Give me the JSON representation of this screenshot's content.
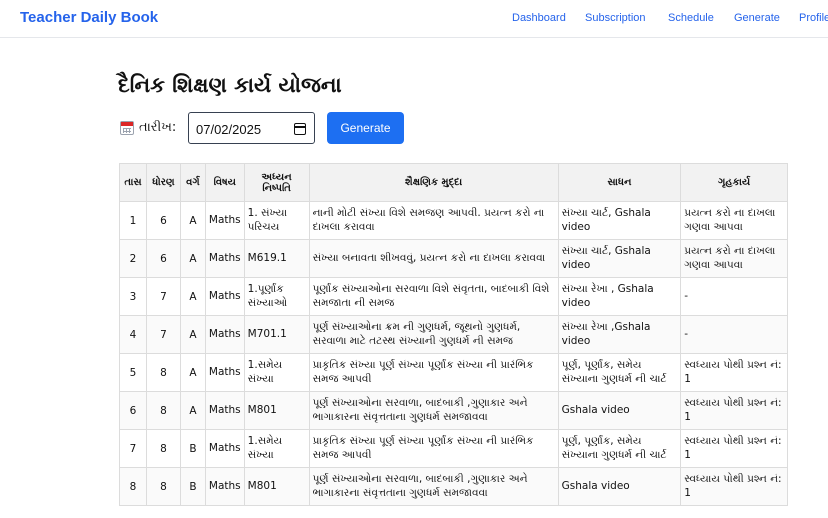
{
  "nav": {
    "brand": "Teacher Daily Book",
    "links": [
      "Dashboard",
      "Subscription",
      "Schedule",
      "Generate",
      "Profile"
    ]
  },
  "page": {
    "title": "દૈનિક શિક્ષણ કાર્ય યોજના",
    "date_label": "તારીખ:",
    "date_value": "07/02/2025",
    "generate_label": "Generate"
  },
  "table": {
    "headers": [
      "તાસ",
      "ધોરણ",
      "વર્ગ",
      "વિષય",
      "અધ્યન નિષ્પતિ",
      "શૈક્ષણિક મુદ્દા",
      "સાધન",
      "ગૃહકાર્ય"
    ],
    "rows": [
      [
        "1",
        "6",
        "A",
        "Maths",
        "1. સંખ્યા પરિચય",
        "નાની મોટી સંખ્યા વિશે સમજણ આપવી. પ્રયત્ન કરો ના દાખલા કરાવવા",
        "સંખ્યા ચાર્ટ, Gshala video",
        "પ્રયત્ન કરો ના દાખલા ગણવા આપવા"
      ],
      [
        "2",
        "6",
        "A",
        "Maths",
        "M619.1",
        "સંખ્યા બનાવતા શીખવવું, પ્રયત્ન કરો ના દાખલા કરાવવા",
        "સંખ્યા ચાર્ટ, Gshala video",
        "પ્રયત્ન કરો ના દાખલા ગણવા આપવા"
      ],
      [
        "3",
        "7",
        "A",
        "Maths",
        "1.પૂર્ણાંક સંખ્યાઓ",
        "પૂર્ણાંક સંખ્યાઓના સરવાળા વિશે સંવૃતતા, બાદબાકી વિશે સમજાતા ની સમજ",
        "સંખ્યા રેખા , Gshala video",
        "-"
      ],
      [
        "4",
        "7",
        "A",
        "Maths",
        "M701.1",
        "પૂર્ણ સંખ્યાઓના ક્રમ ની ગુણધર્મ, જૂથનો ગુણધર્મ, સરવાળા માટે તટસ્થ સંખ્યાની ગુણધર્મ ની સમજ",
        "સંખ્યા રેખા ,Gshala video",
        "-"
      ],
      [
        "5",
        "8",
        "A",
        "Maths",
        "1.સમેય સંખ્યા",
        "પ્રાકૃતિક સંખ્યા પૂર્ણ સંખ્યા પૂર્ણાંક સંખ્યા ની પ્રારંભિક સમજ આપવી",
        "પૂર્ણ, પૂર્ણાંક, સમેય સંખ્યાના ગુણધર્મ ની ચાર્ટ",
        "સ્વધ્યાય પોથી પ્રશ્ન નં: 1"
      ],
      [
        "6",
        "8",
        "A",
        "Maths",
        "M801",
        "પૂર્ણ સંખ્યાઓના સરવાળા, બાદબાકી ,ગુણાકાર અને ભાગાકારના સંવૃત્તતાના ગુણધર્મ સમજાવવા",
        "Gshala video",
        "સ્વધ્યાય પોથી પ્રશ્ન નં: 1"
      ],
      [
        "7",
        "8",
        "B",
        "Maths",
        "1.સમેય સંખ્યા",
        "પ્રાકૃતિક સંખ્યા પૂર્ણ સંખ્યા પૂર્ણાંક સંખ્યા ની પ્રારંભિક સમજ આપવી",
        "પૂર્ણ, પૂર્ણાંક, સમેય સંખ્યાના ગુણધર્મ ની ચાર્ટ",
        "સ્વધ્યાય પોથી પ્રશ્ન નં: 1"
      ],
      [
        "8",
        "8",
        "B",
        "Maths",
        "M801",
        "પૂર્ણ સંખ્યાઓના સરવાળા, બાદબાકી ,ગુણાકાર અને ભાગાકારના સંવૃત્તતાના ગુણધર્મ સમજાવવા",
        "Gshala video",
        "સ્વધ્યાય પોથી પ્રશ્ન નં: 1"
      ]
    ]
  }
}
